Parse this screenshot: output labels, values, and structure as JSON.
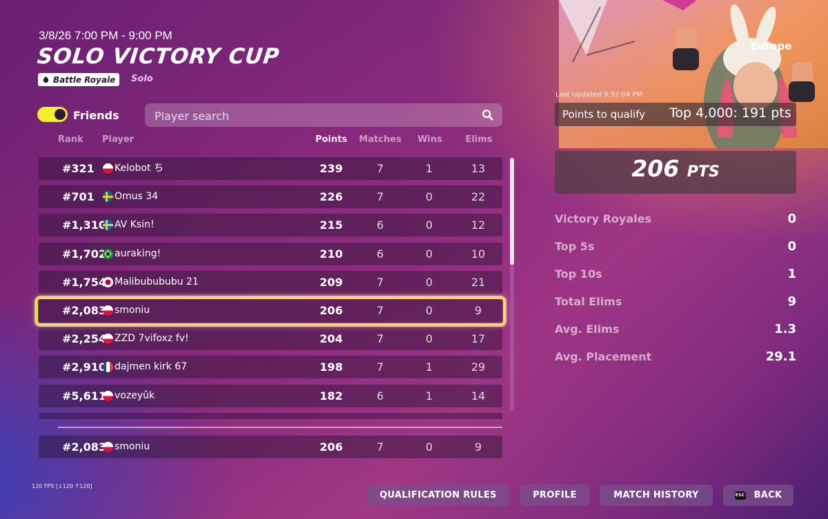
{
  "event": {
    "date_time": "3/8/26 7:00 PM - 9:00 PM",
    "title": "SOLO VICTORY CUP",
    "mode_badge": "Battle Royale",
    "mode_sub": "Solo"
  },
  "filters": {
    "friends_label": "Friends",
    "friends_toggle_on": true,
    "search_placeholder": "Player search"
  },
  "columns": {
    "rank": "Rank",
    "player": "Player",
    "points": "Points",
    "matches": "Matches",
    "wins": "Wins",
    "elims": "Elims"
  },
  "rows": [
    {
      "rank": "#321",
      "flag": "pl",
      "player": "Kelobot ち",
      "points": "239",
      "matches": "7",
      "wins": "1",
      "elims": "13"
    },
    {
      "rank": "#701",
      "flag": "se",
      "player": "Omus 34",
      "points": "226",
      "matches": "7",
      "wins": "0",
      "elims": "22"
    },
    {
      "rank": "#1,310",
      "flag": "se",
      "player": "AV Ksin!",
      "points": "215",
      "matches": "6",
      "wins": "0",
      "elims": "12"
    },
    {
      "rank": "#1,702",
      "flag": "br",
      "player": "auraking!",
      "points": "210",
      "matches": "6",
      "wins": "0",
      "elims": "10"
    },
    {
      "rank": "#1,754",
      "flag": "jp",
      "player": "Malibubububu 21",
      "points": "209",
      "matches": "7",
      "wins": "0",
      "elims": "21"
    },
    {
      "rank": "#2,083",
      "flag": "pl",
      "player": "smoniu",
      "points": "206",
      "matches": "7",
      "wins": "0",
      "elims": "9"
    },
    {
      "rank": "#2,254",
      "flag": "pl",
      "player": "ZZD 7vifoxz fv!",
      "points": "204",
      "matches": "7",
      "wins": "0",
      "elims": "17"
    },
    {
      "rank": "#2,910",
      "flag": "fr",
      "player": "dajmen kirk 67",
      "points": "198",
      "matches": "7",
      "wins": "1",
      "elims": "29"
    },
    {
      "rank": "#5,611",
      "flag": "pl",
      "player": "vozeyûk",
      "points": "182",
      "matches": "6",
      "wins": "1",
      "elims": "14"
    }
  ],
  "self_row": {
    "rank": "#2,083",
    "flag": "pl",
    "player": "smoniu",
    "points": "206",
    "matches": "7",
    "wins": "0",
    "elims": "9"
  },
  "side": {
    "region": "Europe",
    "last_updated": "Last Updated 9:32:04 PM",
    "qualify_label": "Points to qualify",
    "qualify_value": "Top 4,000: 191 pts",
    "points_number": "206",
    "points_unit": "PTS",
    "stats": [
      {
        "label": "Victory Royales",
        "value": "0"
      },
      {
        "label": "Top 5s",
        "value": "0"
      },
      {
        "label": "Top 10s",
        "value": "1"
      },
      {
        "label": "Total Elims",
        "value": "9"
      },
      {
        "label": "Avg. Elims",
        "value": "1.3"
      },
      {
        "label": "Avg. Placement",
        "value": "29.1"
      }
    ]
  },
  "footer": {
    "fps": "120 FPS [↓120 ↑120]",
    "qualification_rules": "QUALIFICATION RULES",
    "profile": "PROFILE",
    "match_history": "MATCH HISTORY",
    "back": "BACK",
    "back_key": "ESC"
  },
  "colors": {
    "highlight": "#f1ea2b",
    "toggle": "#f4ef2d"
  }
}
